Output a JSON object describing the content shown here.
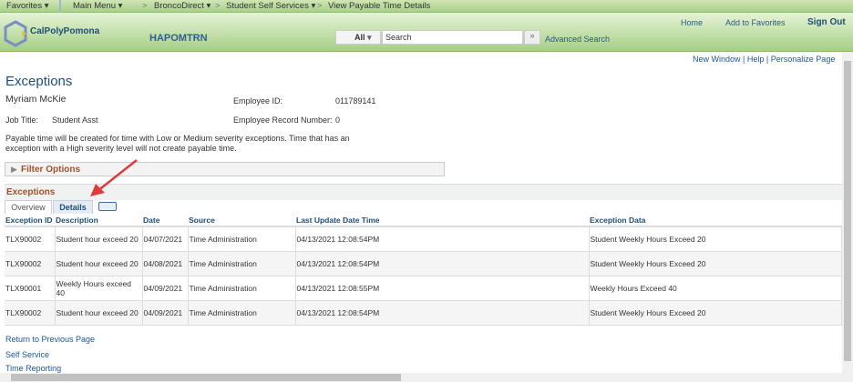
{
  "nav": {
    "favorites": "Favorites ▾",
    "main_menu": "Main Menu ▾",
    "breadcrumbs": [
      "BroncoDirect ▾",
      "Student Self Services ▾",
      "View Payable Time Details"
    ]
  },
  "header": {
    "logo": "CalPolyPomona",
    "system": "HAPOMTRN",
    "home": "Home",
    "add_favorites": "Add to Favorites",
    "sign_out": "Sign Out",
    "search_scope": "All",
    "search_placeholder": "Search",
    "advanced_search": "Advanced Search"
  },
  "page_links": {
    "new_window": "New Window",
    "help": "Help",
    "personalize": "Personalize Page"
  },
  "page": {
    "title": "Exceptions",
    "employee_name": "Myriam McKie",
    "employee_id_label": "Employee ID:",
    "employee_id": "011789141",
    "job_title_label": "Job Title:",
    "job_title": "Student Asst",
    "record_label": "Employee Record Number:",
    "record_number": "0",
    "note": "Payable time will be created for time with Low or Medium severity exceptions. Time that has an exception with a High severity level will not create payable time.",
    "filter_options": "Filter Options"
  },
  "grid": {
    "title": "Exceptions",
    "tabs": [
      "Overview",
      "Details"
    ],
    "active_tab": "Details",
    "columns": [
      "Exception ID",
      "Description",
      "Date",
      "Source",
      "Last Update Date Time",
      "Exception Data"
    ],
    "rows": [
      [
        "TLX90002",
        "Student hour exceed 20",
        "04/07/2021",
        "Time Administration",
        "04/13/2021 12:08:54PM",
        "Student Weekly Hours Exceed 20"
      ],
      [
        "TLX90002",
        "Student hour exceed 20",
        "04/08/2021",
        "Time Administration",
        "04/13/2021 12:08:54PM",
        "Student Weekly Hours Exceed 20"
      ],
      [
        "TLX90001",
        "Weekly Hours exceed 40",
        "04/09/2021",
        "Time Administration",
        "04/13/2021 12:08:55PM",
        "Weekly Hours Exceed 40"
      ],
      [
        "TLX90002",
        "Student hour exceed 20",
        "04/09/2021",
        "Time Administration",
        "04/13/2021 12:08:54PM",
        "Student Weekly Hours Exceed 20"
      ]
    ]
  },
  "footer_links": [
    "Return to Previous Page",
    "Self Service",
    "Time Reporting"
  ]
}
